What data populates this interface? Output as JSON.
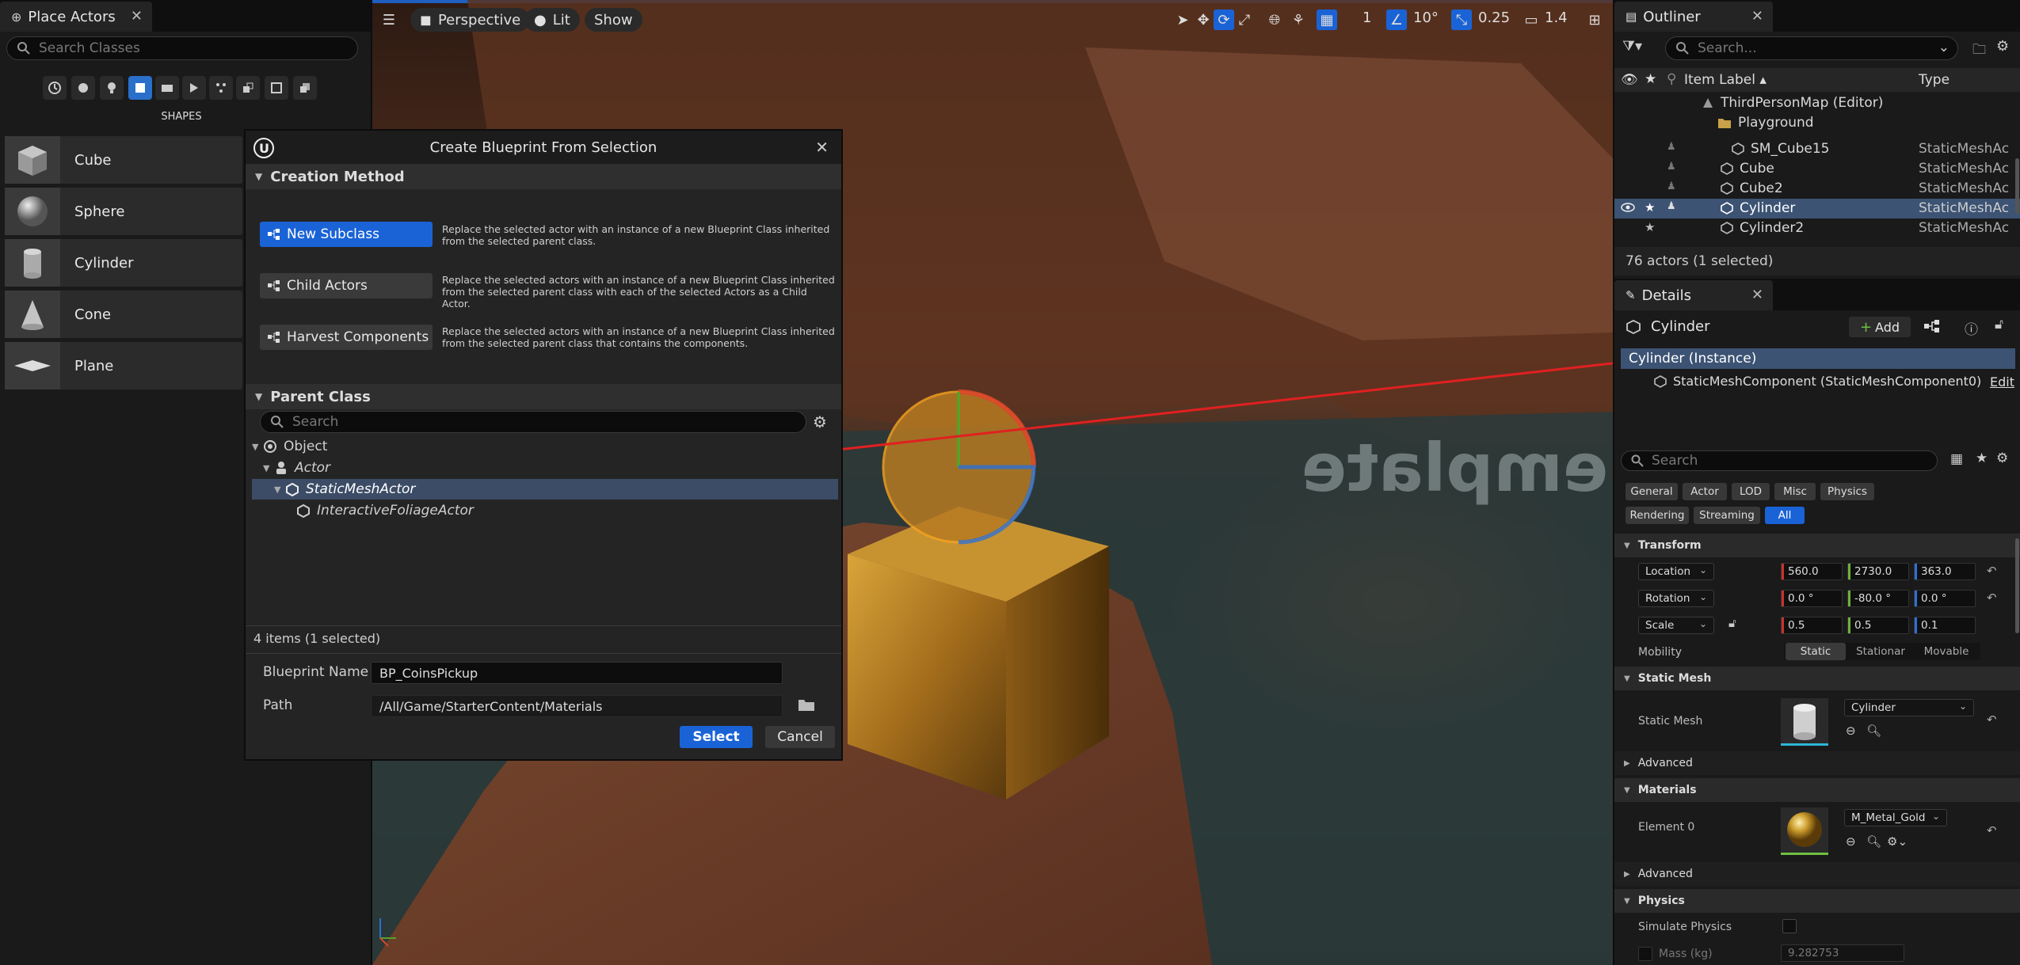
{
  "left_panel": {
    "tab_title": "Place Actors",
    "search_placeholder": "Search Classes",
    "section_title": "SHAPES",
    "shapes": [
      {
        "label": "Cube"
      },
      {
        "label": "Sphere"
      },
      {
        "label": "Cylinder"
      },
      {
        "label": "Cone"
      },
      {
        "label": "Plane"
      }
    ]
  },
  "viewport": {
    "view_mode": "Perspective",
    "lighting": "Lit",
    "show": "Show",
    "grid_snap": "1",
    "rotation_snap": "10°",
    "scale_snap": "0.25",
    "camera_speed": "1.4",
    "watermark": "emplate"
  },
  "dialog": {
    "title": "Create Blueprint From Selection",
    "creation_method_header": "Creation Method",
    "methods": [
      {
        "label": "New Subclass",
        "desc": "Replace the selected actor with an instance of a new Blueprint Class inherited from the selected parent class."
      },
      {
        "label": "Child Actors",
        "desc": "Replace the selected actors with an instance of a new Blueprint Class inherited from the selected parent class with each of the selected Actors as a Child Actor."
      },
      {
        "label": "Harvest Components",
        "desc": "Replace the selected actors with an instance of a new Blueprint Class inherited from the selected parent class that contains the components."
      }
    ],
    "parent_class_header": "Parent Class",
    "search_placeholder": "Search",
    "tree": [
      {
        "label": "Object"
      },
      {
        "label": "Actor"
      },
      {
        "label": "StaticMeshActor"
      },
      {
        "label": "InteractiveFoliageActor"
      }
    ],
    "item_count": "4 items (1 selected)",
    "blueprint_name_label": "Blueprint Name",
    "blueprint_name_value": "BP_CoinsPickup",
    "path_label": "Path",
    "path_value": "/All/Game/StarterContent/Materials",
    "select_label": "Select",
    "cancel_label": "Cancel"
  },
  "outliner": {
    "tab_title": "Outliner",
    "search_placeholder": "Search...",
    "col_label": "Item Label",
    "col_type": "Type",
    "rows": [
      {
        "name": "ThirdPersonMap (Editor)",
        "type": ""
      },
      {
        "name": "Playground",
        "type": ""
      },
      {
        "name": "SM_Cube15",
        "type": "StaticMeshAc"
      },
      {
        "name": "Cube",
        "type": "StaticMeshAc"
      },
      {
        "name": "Cube2",
        "type": "StaticMeshAc"
      },
      {
        "name": "Cylinder",
        "type": "StaticMeshAc"
      },
      {
        "name": "Cylinder2",
        "type": "StaticMeshAc"
      }
    ],
    "status": "76 actors (1 selected)"
  },
  "details": {
    "tab_title": "Details",
    "actor_name": "Cylinder",
    "add_label": "Add",
    "instance_label": "Cylinder (Instance)",
    "component_label": "StaticMeshComponent (StaticMeshComponent0)",
    "edit_label": "Edit",
    "search_placeholder": "Search",
    "filters": [
      "General",
      "Actor",
      "LOD",
      "Misc",
      "Physics",
      "Rendering",
      "Streaming",
      "All"
    ],
    "transform_header": "Transform",
    "location_label": "Location",
    "location": [
      "560.0",
      "2730.0",
      "363.0"
    ],
    "rotation_label": "Rotation",
    "rotation": [
      "0.0 °",
      "-80.0 °",
      "0.0 °"
    ],
    "scale_label": "Scale",
    "scale": [
      "0.5",
      "0.5",
      "0.1"
    ],
    "mobility_label": "Mobility",
    "mobility": [
      "Static",
      "Stationar",
      "Movable"
    ],
    "static_mesh_header": "Static Mesh",
    "static_mesh_label": "Static Mesh",
    "static_mesh_value": "Cylinder",
    "advanced_label": "Advanced",
    "materials_header": "Materials",
    "element0_label": "Element 0",
    "material_value": "M_Metal_Gold",
    "physics_header": "Physics",
    "simulate_label": "Simulate Physics",
    "mass_label": "Mass (kg)",
    "mass_value": "9.282753"
  }
}
